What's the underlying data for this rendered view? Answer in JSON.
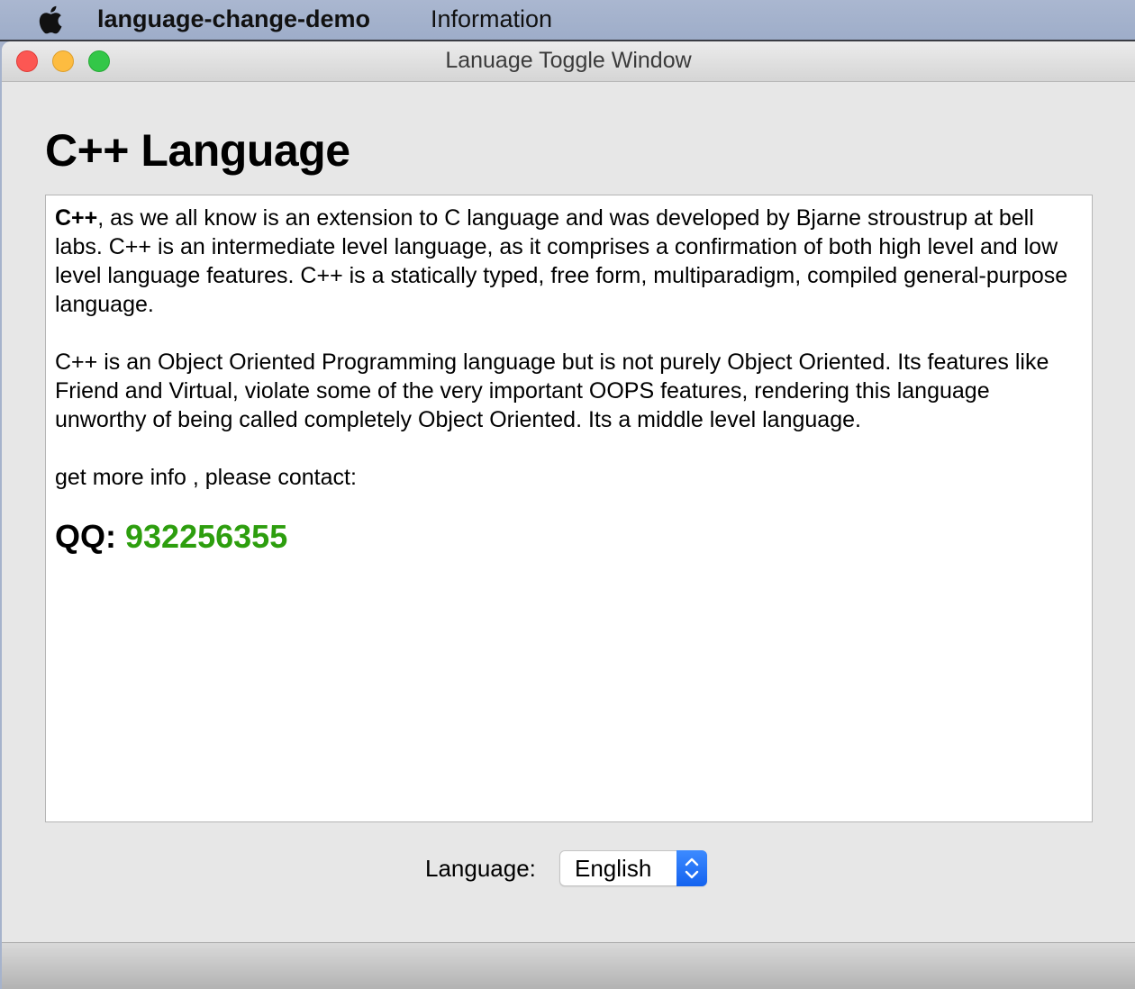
{
  "menubar": {
    "apple_icon": "apple-icon",
    "app_name": "language-change-demo",
    "menu_information": "Information"
  },
  "window": {
    "title": "Lanuage Toggle Window",
    "traffic_lights": {
      "close": "#fc5753",
      "minimize": "#fdbc40",
      "zoom": "#33c748"
    }
  },
  "main": {
    "heading": "C++ Language",
    "paragraph1_bold": "C++",
    "paragraph1_rest": ", as we all know is an extension to C language and was developed by Bjarne stroustrup at bell labs. C++ is an intermediate level language, as it comprises a confirmation of both high level and low level language features. C++ is a statically typed, free form, multiparadigm, compiled general-purpose language.",
    "paragraph2": "C++ is an Object Oriented Programming language but is not purely Object Oriented. Its features like Friend and Virtual, violate some of the very important OOPS features, rendering this language unworthy of being called completely Object Oriented. Its a middle level language.",
    "contact_line": "get more info , please contact:",
    "qq_label": "QQ:",
    "qq_number": "932256355",
    "qq_color": "#2d9e0e"
  },
  "language_selector": {
    "label": "Language:",
    "selected": "English",
    "accent_color": "#1f6ff5"
  }
}
